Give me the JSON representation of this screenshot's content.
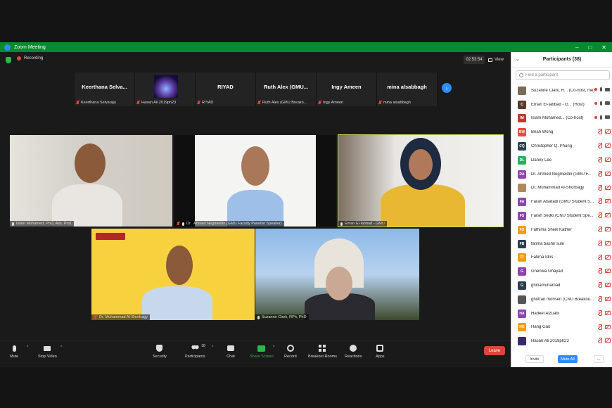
{
  "window": {
    "title": "Zoom Meeting"
  },
  "meeting": {
    "recording_label": "Recording",
    "timer": "02:53:54",
    "view_label": "View"
  },
  "thumbnails": [
    {
      "display": "Keerthana  Selva...",
      "label": "Keerthana Selvaraju"
    },
    {
      "display": "",
      "label": "Hasan Ali 2019ph23"
    },
    {
      "display": "RIYAD",
      "label": "RIYAD"
    },
    {
      "display": "Ruth Alex (GMU...",
      "label": "Ruth Alex (GMU Breako..."
    },
    {
      "display": "Ingy Ameen",
      "label": "Ingy Ameen"
    },
    {
      "display": "mina alsabbagh",
      "label": "mina alsabbagh"
    }
  ],
  "videos": {
    "islam": "Islam Mohamed, PhD, Ass. Prof.",
    "ahmed_prefix": "Dr.",
    "ahmed": "Ahmed Negmeldin (GMU Faculty Panelist Speaker)",
    "eman": "Eman El-labbad - GMU",
    "muhammad": "Dr. Muhammad Al-Shorbagy",
    "suzanne": "Suzanne Clark, RPh, PhD"
  },
  "controls": {
    "mute": "Mute",
    "stop_video": "Stop Video",
    "security": "Security",
    "participants": "Participants",
    "participants_count": "38",
    "chat": "Chat",
    "share_screen": "Share Screen",
    "record": "Record",
    "breakout_rooms": "Breakout Rooms",
    "reactions": "Reactions",
    "apps": "Apps",
    "leave": "Leave"
  },
  "panel": {
    "title": "Participants (38)",
    "search_placeholder": "Find a participant",
    "invite": "Invite",
    "mute_all": "Mute All",
    "more": "..."
  },
  "participants": [
    {
      "initials": "",
      "name": "Suzanne Clark, R... (Co-host, me)",
      "color": "#7a6a5a",
      "mic": "on",
      "cam": "on"
    },
    {
      "initials": "C",
      "name": "Eman El-labbad - G... (Host)",
      "color": "#5a3a2a",
      "mic": "on",
      "cam": "on"
    },
    {
      "initials": "IM",
      "name": "Islam Mohamed... (Co-host)",
      "color": "#c0392b",
      "mic": "on",
      "cam": "on"
    },
    {
      "initials": "BW",
      "name": "Brian Wong",
      "color": "#e74c3c",
      "mic": "off",
      "cam": "off"
    },
    {
      "initials": "CQ",
      "name": "Christopher Q. Phung",
      "color": "#2c3e50",
      "mic": "off",
      "cam": "off"
    },
    {
      "initials": "DL",
      "name": "Danny Lee",
      "color": "#27ae60",
      "mic": "off",
      "cam": "off"
    },
    {
      "initials": "DA",
      "name": "Dr. Ahmed Negmeldin (GMU F...",
      "color": "#8e44ad",
      "mic": "off",
      "cam": "off"
    },
    {
      "initials": "",
      "name": "Dr. Muhammad Al-Shorbagy",
      "color": "#b08860",
      "mic": "off",
      "cam": "off"
    },
    {
      "initials": "FA",
      "name": "Farah Alsafadi (GMU Student S...",
      "color": "#8e44ad",
      "mic": "off",
      "cam": "off"
    },
    {
      "initials": "FS",
      "name": "Farah Sedki (CNU Student Spe...",
      "color": "#8e44ad",
      "mic": "off",
      "cam": "off"
    },
    {
      "initials": "FS",
      "name": "Fathima Sheik Kather",
      "color": "#f39c12",
      "mic": "off",
      "cam": "off"
    },
    {
      "initials": "FB",
      "name": "fatima bashir sule",
      "color": "#2c3e50",
      "mic": "off",
      "cam": "off"
    },
    {
      "initials": "FI",
      "name": "Fatima Idris",
      "color": "#f39c12",
      "mic": "off",
      "cam": "off"
    },
    {
      "initials": "G",
      "name": "Ghenwa Ghayad",
      "color": "#8e44ad",
      "mic": "off",
      "cam": "off"
    },
    {
      "initials": "G",
      "name": "ghinamuhamad",
      "color": "#2c3e50",
      "mic": "off",
      "cam": "off"
    },
    {
      "initials": "",
      "name": "ghofran mohsen (CNU Breakou...",
      "color": "#555555",
      "mic": "off",
      "cam": "off"
    },
    {
      "initials": "HA",
      "name": "Hadeel Alzuabi",
      "color": "#8e44ad",
      "mic": "off",
      "cam": "off"
    },
    {
      "initials": "HG",
      "name": "Hang Gao",
      "color": "#f39c12",
      "mic": "off",
      "cam": "off"
    },
    {
      "initials": "",
      "name": "Hasan Ali 2019ph23",
      "color": "#3a2a6a",
      "mic": "off",
      "cam": "off"
    }
  ]
}
